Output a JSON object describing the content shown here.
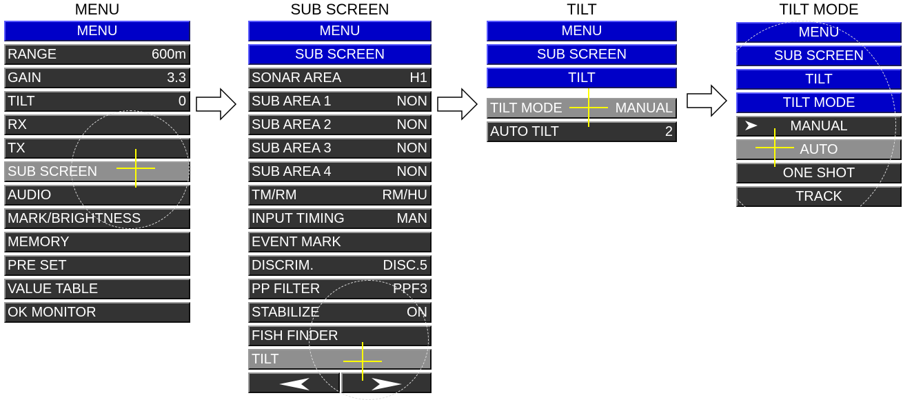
{
  "panels": [
    {
      "title": "MENU",
      "items": [
        {
          "label": "MENU"
        },
        {
          "label": "RANGE",
          "value": "600m"
        },
        {
          "label": "GAIN",
          "value": "3.3"
        },
        {
          "label": "TILT",
          "value": "0"
        },
        {
          "label": "RX"
        },
        {
          "label": "TX"
        },
        {
          "label": "SUB SCREEN"
        },
        {
          "label": "AUDIO"
        },
        {
          "label": "MARK/BRIGHTNESS"
        },
        {
          "label": "MEMORY"
        },
        {
          "label": "PRE SET"
        },
        {
          "label": "VALUE TABLE"
        },
        {
          "label": "OK MONITOR"
        }
      ]
    },
    {
      "title": "SUB SCREEN",
      "items": [
        {
          "label": "MENU"
        },
        {
          "label": "SUB SCREEN"
        },
        {
          "label": "SONAR AREA",
          "value": "H1"
        },
        {
          "label": "SUB AREA 1",
          "value": "NON"
        },
        {
          "label": "SUB AREA 2",
          "value": "NON"
        },
        {
          "label": "SUB AREA 3",
          "value": "NON"
        },
        {
          "label": "SUB AREA 4",
          "value": "NON"
        },
        {
          "label": "TM/RM",
          "value": "RM/HU"
        },
        {
          "label": "INPUT TIMING",
          "value": "MAN"
        },
        {
          "label": "EVENT MARK"
        },
        {
          "label": "DISCRIM.",
          "value": "DISC.5"
        },
        {
          "label": "PP FILTER",
          "value": "PPF3"
        },
        {
          "label": "STABILIZE",
          "value": "ON"
        },
        {
          "label": "FISH FINDER"
        },
        {
          "label": "TILT"
        }
      ]
    },
    {
      "title": "TILT",
      "items": [
        {
          "label": "MENU"
        },
        {
          "label": "SUB SCREEN"
        },
        {
          "label": "TILT"
        },
        {
          "label": "TILT MODE",
          "value": "MANUAL"
        },
        {
          "label": "AUTO TILT",
          "value": "2"
        }
      ]
    },
    {
      "title": "TILT MODE",
      "items": [
        {
          "label": "MENU"
        },
        {
          "label": "SUB SCREEN"
        },
        {
          "label": "TILT"
        },
        {
          "label": "TILT MODE"
        },
        {
          "label": "MANUAL"
        },
        {
          "label": "AUTO"
        },
        {
          "label": "ONE SHOT"
        },
        {
          "label": "TRACK"
        }
      ]
    }
  ],
  "icons": {
    "flow_arrow": "right-arrow-outline-icon",
    "nav_prev": "left-arrowhead-icon",
    "nav_next": "right-arrowhead-icon",
    "selected_marker": "arrowhead-marker-icon",
    "cursor": "crosshair-cursor-icon"
  },
  "colors": {
    "header_bg": "#0000c8",
    "item_bg": "#333333",
    "highlight_bg": "#8f8f8f",
    "cursor": "#ffff00",
    "text": "#ffffff"
  }
}
